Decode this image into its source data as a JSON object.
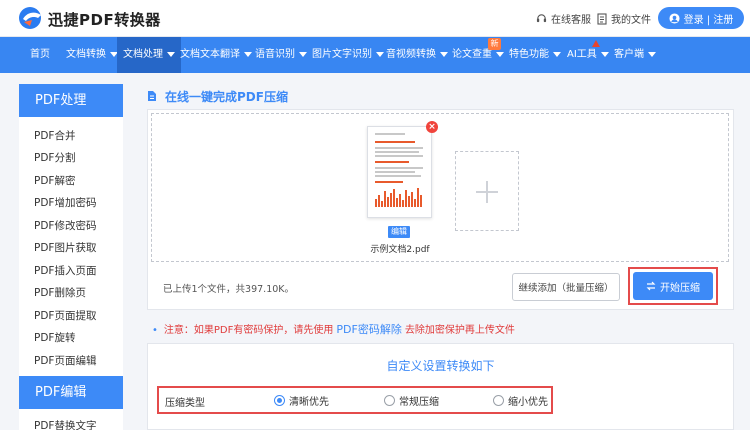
{
  "header": {
    "logo_text": "迅捷PDF转换器",
    "service_label": "在线客服",
    "my_files_label": "我的文件",
    "login_label": "登录 | 注册"
  },
  "nav": {
    "items": [
      {
        "label": "首页",
        "caret": false
      },
      {
        "label": "文档转换",
        "caret": true
      },
      {
        "label": "文档处理",
        "caret": true
      },
      {
        "label": "文档文本翻译",
        "caret": true
      },
      {
        "label": "语音识别",
        "caret": true
      },
      {
        "label": "图片文字识别",
        "caret": true
      },
      {
        "label": "音视频转换",
        "caret": true
      },
      {
        "label": "论文查重",
        "caret": true
      },
      {
        "label": "特色功能",
        "caret": true
      },
      {
        "label": "AI工具",
        "caret": true
      },
      {
        "label": "客户端",
        "caret": true
      }
    ],
    "badge_new": "新"
  },
  "sidebar": {
    "section1_title": "PDF处理",
    "section1_items": [
      "PDF合并",
      "PDF分割",
      "PDF解密",
      "PDF增加密码",
      "PDF修改密码",
      "PDF图片获取",
      "PDF插入页面",
      "PDF删除页",
      "PDF页面提取",
      "PDF旋转",
      "PDF页面编辑"
    ],
    "section2_title": "PDF编辑",
    "section2_items": [
      "PDF替换文字"
    ]
  },
  "main": {
    "title": "在线一键完成PDF压缩",
    "file": {
      "edit_label": "编辑",
      "name": "示例文档2.pdf"
    },
    "status": "已上传1个文件，共397.10K。",
    "add_more_label": "继续添加（批量压缩）",
    "start_label": "开始压缩",
    "notice_prefix": "注意：如果PDF有密码保护，请先使用",
    "notice_link": "PDF密码解除",
    "notice_suffix": "去除加密保护再上传文件"
  },
  "settings": {
    "title": "自定义设置转换如下",
    "type_label": "压缩类型",
    "options": [
      {
        "label": "清晰优先",
        "selected": true
      },
      {
        "label": "常规压缩",
        "selected": false
      },
      {
        "label": "缩小优先",
        "selected": false
      }
    ]
  },
  "colors": {
    "accent": "#3d8af7",
    "nav": "#3886f2",
    "nav_active": "#2667c8",
    "highlight_border": "#e44b4b",
    "notice": "#e03c3c"
  }
}
